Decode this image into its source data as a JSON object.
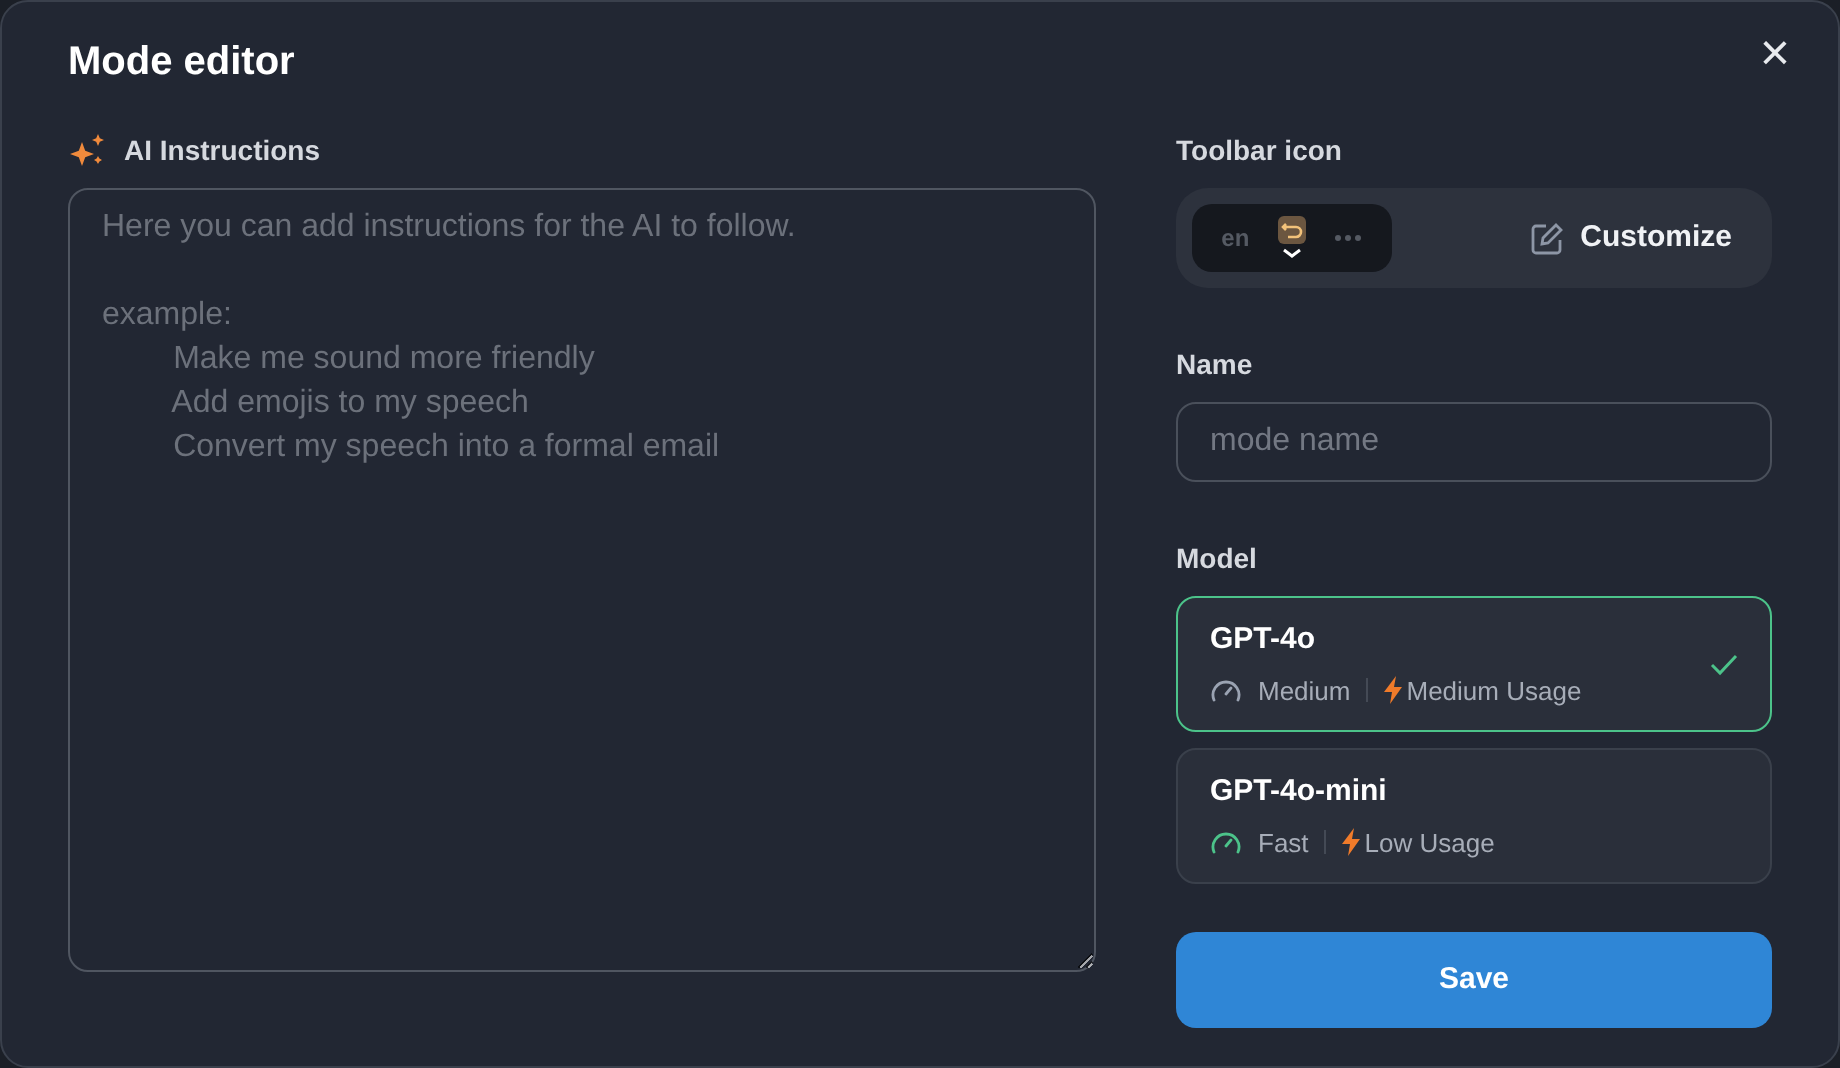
{
  "dialog": {
    "title": "Mode editor",
    "close": "×"
  },
  "instructions": {
    "label": "AI Instructions",
    "placeholder": "Here you can add instructions for the AI to follow.\n\nexample:\n        Make me sound more friendly\n        Add emojis to my speech\n        Convert my speech into a formal email"
  },
  "toolbar_icon": {
    "label": "Toolbar icon",
    "preview_text": "en",
    "customize": "Customize"
  },
  "name": {
    "label": "Name",
    "placeholder": "mode name"
  },
  "model": {
    "label": "Model",
    "options": [
      {
        "name": "GPT-4o",
        "speed": "Medium",
        "color": "#9aa3b2",
        "usage": "Medium Usage",
        "selected": true
      },
      {
        "name": "GPT-4o-mini",
        "speed": "Fast",
        "color": "#4cc38a",
        "usage": "Low Usage",
        "selected": false
      }
    ]
  },
  "save": "Save"
}
